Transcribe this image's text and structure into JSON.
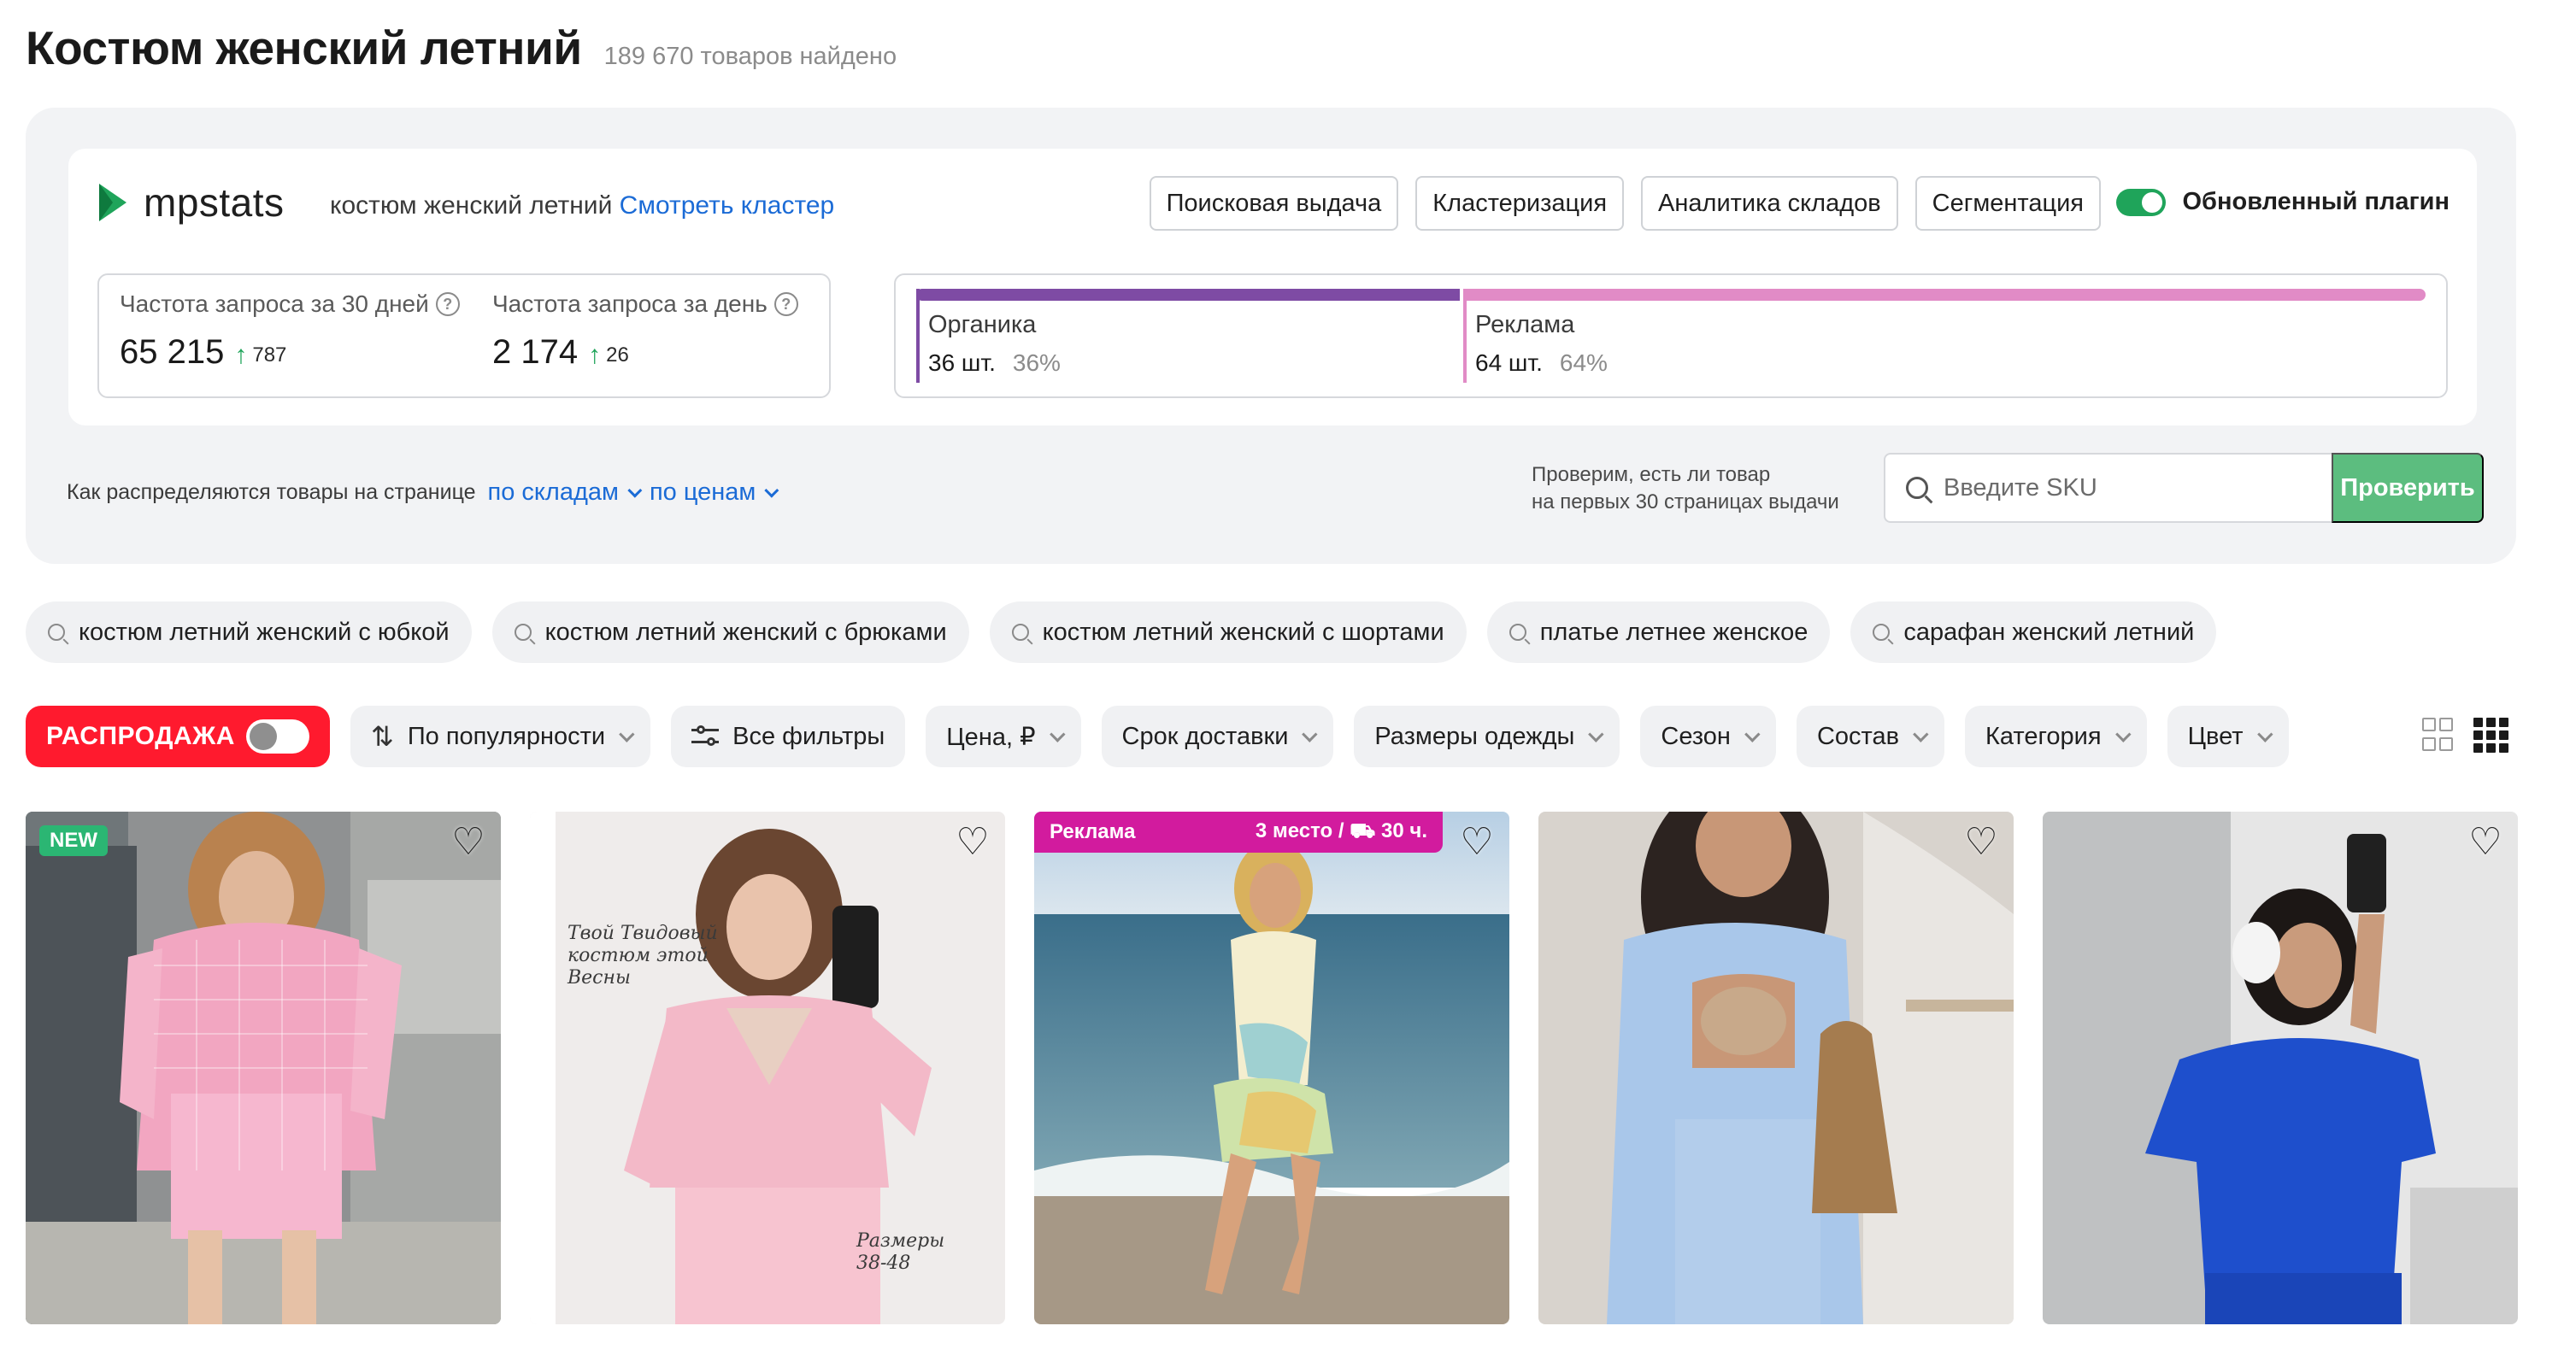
{
  "header": {
    "title": "Костюм женский летний",
    "found": "189 670 товаров найдено"
  },
  "plugin": {
    "logo_text": "mpstats",
    "query": "костюм женский летний",
    "cluster_link": "Смотреть кластер",
    "buttons": [
      "Поисковая выдача",
      "Кластеризация",
      "Аналитика складов",
      "Сегментация"
    ],
    "updated_plugin_label": "Обновленный плагин",
    "updated_plugin_on": true,
    "freq_30_label": "Частота запроса за 30 дней",
    "freq_30_value": "65 215",
    "freq_30_delta": "787",
    "freq_day_label": "Частота запроса за день",
    "freq_day_value": "2 174",
    "freq_day_delta": "26",
    "organic_label": "Органика",
    "organic_count": "36 шт.",
    "organic_pct": "36%",
    "organic_share": 0.36,
    "ads_label": "Реклама",
    "ads_count": "64 шт.",
    "ads_pct": "64%",
    "distribution_text": "Как распределяются товары на странице",
    "by_warehouses": "по складам",
    "by_prices": "по ценам",
    "sku_hint_line1": "Проверим, есть ли товар",
    "sku_hint_line2": "на первых 30 страницах выдачи",
    "sku_placeholder": "Введите SKU",
    "sku_button": "Проверить"
  },
  "colors": {
    "organic": "#7e4ba4",
    "ads": "#e18bc6",
    "sale": "#ff1a2e",
    "green": "#1fa45a",
    "check_button": "#5cbd7f",
    "ad_badge": "#d21b9e"
  },
  "suggestions": [
    "костюм летний женский с юбкой",
    "костюм летний женский с брюками",
    "костюм летний женский с шортами",
    "платье летнее женское",
    "сарафан женский летний"
  ],
  "filters": {
    "sale_label": "РАСПРОДАЖА",
    "sort_label": "По популярности",
    "all_filters": "Все фильтры",
    "items": [
      "Цена, ₽",
      "Срок доставки",
      "Размеры одежды",
      "Сезон",
      "Состав",
      "Категория",
      "Цвет"
    ]
  },
  "products": {
    "badge_new": "NEW",
    "ad_label": "Реклама",
    "ad_position": "3 место / ⛟ 30 ч.",
    "promo_line1": "Твой Твидовый",
    "promo_line2": "костюм этой",
    "promo_line3": "Весны",
    "sizes_line1": "Размеры",
    "sizes_line2": "38-48"
  },
  "icons": {
    "logo": "mpstats-logo-icon",
    "help": "help-circle-icon",
    "up": "arrow-up-icon",
    "search": "search-icon",
    "chevron": "chevron-down-icon",
    "sort": "sort-icon",
    "filters": "sliders-icon",
    "heart": "heart-icon",
    "grid2": "grid-2-icon",
    "grid3": "grid-3-icon"
  }
}
